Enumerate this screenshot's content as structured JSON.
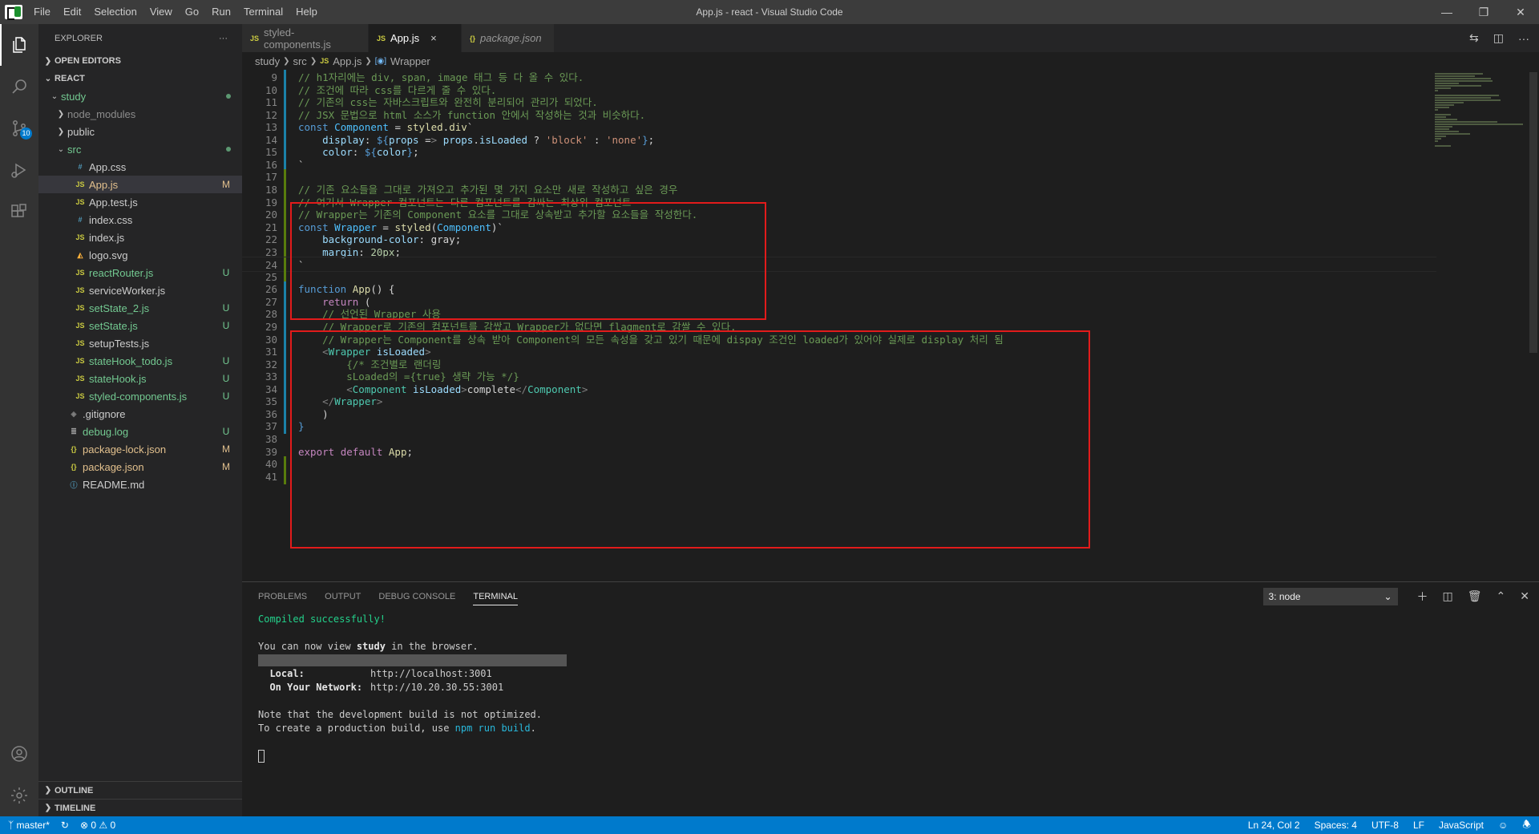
{
  "window": {
    "title": "App.js - react - Visual Studio Code"
  },
  "menu": [
    "File",
    "Edit",
    "Selection",
    "View",
    "Go",
    "Run",
    "Terminal",
    "Help"
  ],
  "activity": {
    "scm_badge": "10"
  },
  "explorer": {
    "title": "EXPLORER",
    "open_editors": "OPEN EDITORS",
    "root": "REACT",
    "outline": "OUTLINE",
    "timeline": "TIMELINE",
    "files": [
      {
        "name": "study",
        "icon": "",
        "status": "",
        "type": "folder"
      },
      {
        "name": "node_modules",
        "icon": "",
        "status": "",
        "type": "folder"
      },
      {
        "name": "public",
        "icon": "",
        "status": "",
        "type": "folder"
      },
      {
        "name": "src",
        "icon": "",
        "status": "",
        "type": "folder"
      },
      {
        "name": "App.css",
        "icon": "#",
        "status": ""
      },
      {
        "name": "App.js",
        "icon": "JS",
        "status": "M"
      },
      {
        "name": "App.test.js",
        "icon": "JS",
        "status": ""
      },
      {
        "name": "index.css",
        "icon": "#",
        "status": ""
      },
      {
        "name": "index.js",
        "icon": "JS",
        "status": ""
      },
      {
        "name": "logo.svg",
        "icon": "◭",
        "status": ""
      },
      {
        "name": "reactRouter.js",
        "icon": "JS",
        "status": "U"
      },
      {
        "name": "serviceWorker.js",
        "icon": "JS",
        "status": ""
      },
      {
        "name": "setState_2.js",
        "icon": "JS",
        "status": "U"
      },
      {
        "name": "setState.js",
        "icon": "JS",
        "status": "U"
      },
      {
        "name": "setupTests.js",
        "icon": "JS",
        "status": ""
      },
      {
        "name": "stateHook_todo.js",
        "icon": "JS",
        "status": "U"
      },
      {
        "name": "stateHook.js",
        "icon": "JS",
        "status": "U"
      },
      {
        "name": "styled-components.js",
        "icon": "JS",
        "status": "U"
      },
      {
        "name": ".gitignore",
        "icon": "◈",
        "status": ""
      },
      {
        "name": "debug.log",
        "icon": "≣",
        "status": "U"
      },
      {
        "name": "package-lock.json",
        "icon": "{}",
        "status": "M"
      },
      {
        "name": "package.json",
        "icon": "{}",
        "status": "M"
      },
      {
        "name": "README.md",
        "icon": "ⓘ",
        "status": ""
      }
    ]
  },
  "tabs": [
    {
      "label": "styled-components.js",
      "icon": "JS"
    },
    {
      "label": "App.js",
      "icon": "JS",
      "close": "×"
    },
    {
      "label": "package.json",
      "icon": "{}"
    }
  ],
  "breadcrumb": [
    "study",
    "src",
    "App.js",
    "Wrapper"
  ],
  "code_lines": [
    {
      "n": "9",
      "text": "// h1자리에는 div, span, image 태그 등 다 올 수 있다."
    },
    {
      "n": "10",
      "text": "// 조건에 따라 css를 다르게 줄 수 있다."
    },
    {
      "n": "11",
      "text": "// 기존의 css는 자바스크립트와 완전히 분리되어 관리가 되었다."
    },
    {
      "n": "12",
      "text": "// JSX 문법으로 html 소스가 function 안에서 작성하는 것과 비슷하다."
    },
    {
      "n": "13",
      "text": "const Component = styled.div`"
    },
    {
      "n": "14",
      "text": "    display: ${props => props.isLoaded ? 'block' : 'none'};"
    },
    {
      "n": "15",
      "text": "    color: ${color};"
    },
    {
      "n": "16",
      "text": "`"
    },
    {
      "n": "17",
      "text": ""
    },
    {
      "n": "18",
      "text": "// 기존 요소들을 그대로 가져오고 추가된 몇 가지 요소만 새로 작성하고 싶은 경우"
    },
    {
      "n": "19",
      "text": "// 여기서 Wrapper 컴포넌트는 다른 컴포넌트를 감싸는 최상위 컴포넌트"
    },
    {
      "n": "20",
      "text": "// Wrapper는 기존의 Component 요소를 그대로 상속받고 추가할 요소들을 작성한다."
    },
    {
      "n": "21",
      "text": "const Wrapper = styled(Component)`"
    },
    {
      "n": "22",
      "text": "    background-color: gray;"
    },
    {
      "n": "23",
      "text": "    margin: 20px;"
    },
    {
      "n": "24",
      "text": "`"
    },
    {
      "n": "25",
      "text": ""
    },
    {
      "n": "26",
      "text": "function App() {"
    },
    {
      "n": "27",
      "text": "    return ("
    },
    {
      "n": "28",
      "text": "    // 선언된 Wrapper 사용"
    },
    {
      "n": "29",
      "text": "    // Wrapper로 기존의 컴포넌트를 감쌌고 Wrapper가 없다면 flagment로 감쌀 수 있다."
    },
    {
      "n": "30",
      "text": "    // Wrapper는 Component를 상속 받아 Component의 모든 속성을 갖고 있기 때문에 dispay 조건인 loaded가 있어야 실제로 display 처리 됨"
    },
    {
      "n": "31",
      "text": "    <Wrapper isLoaded>"
    },
    {
      "n": "32",
      "text": "        {/* 조건별로 랜더링"
    },
    {
      "n": "33",
      "text": "        sLoaded의 ={true} 생략 가능 */}"
    },
    {
      "n": "34",
      "text": "        <Component isLoaded>complete</Component>"
    },
    {
      "n": "35",
      "text": "    </Wrapper>"
    },
    {
      "n": "36",
      "text": "    )"
    },
    {
      "n": "37",
      "text": "}"
    },
    {
      "n": "38",
      "text": ""
    },
    {
      "n": "39",
      "text": "export default App;"
    },
    {
      "n": "40",
      "text": ""
    },
    {
      "n": "41",
      "text": ""
    }
  ],
  "panel": {
    "tabs": [
      "PROBLEMS",
      "OUTPUT",
      "DEBUG CONSOLE",
      "TERMINAL"
    ],
    "terminal_select": "3: node",
    "terminal": {
      "compiled": "Compiled successfully!",
      "view_pre": "You can now view ",
      "view_app": "study",
      "view_post": " in the browser.",
      "local_label": "  Local:",
      "local_url": "http://localhost:3001",
      "network_label": "  On Your Network:",
      "network_url": "http://10.20.30.55:3001",
      "note1": "Note that the development build is not optimized.",
      "note2_pre": "To create a production build, use ",
      "note2_cmd": "npm run build",
      "note2_post": "."
    }
  },
  "status": {
    "branch": "master*",
    "errors": "0",
    "warnings": "0",
    "position": "Ln 24, Col 2",
    "spaces": "Spaces: 4",
    "encoding": "UTF-8",
    "eol": "LF",
    "language": "JavaScript"
  }
}
